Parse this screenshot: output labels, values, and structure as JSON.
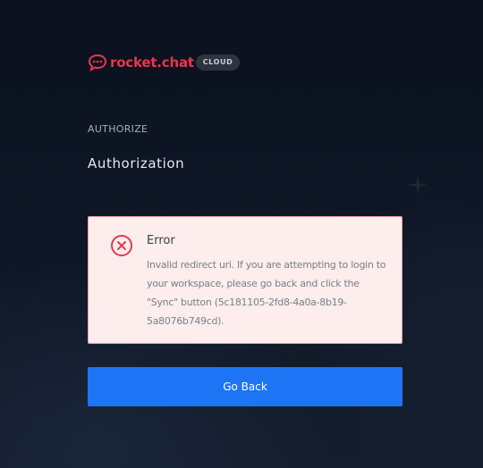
{
  "brand": {
    "logo_text": "rocket.chat",
    "badge": "CLOUD",
    "brand_color": "#e8374a"
  },
  "section_label": "AUTHORIZE",
  "page_title": "Authorization",
  "error": {
    "icon": "x-circle-icon",
    "title": "Error",
    "message": "Invalid redirect uri. If you are attempting to login to your workspace, please go back and click the \"Sync\" button (5c181105-2fd8-4a0a-8b19-5a8076b749cd).",
    "accent_color": "#e8374a",
    "background_color": "#fdeded"
  },
  "actions": {
    "go_back_label": "Go Back",
    "primary_color": "#1d74f5"
  }
}
